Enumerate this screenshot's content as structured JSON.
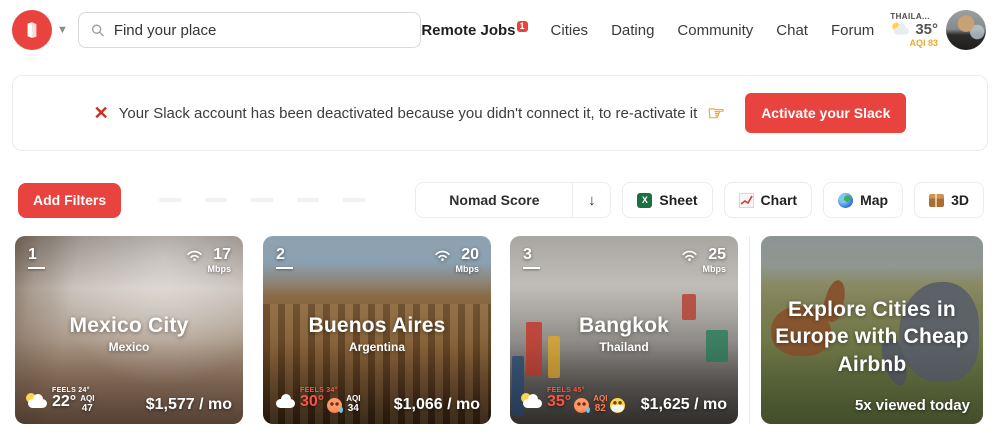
{
  "colors": {
    "accent": "#e8433f",
    "hot_red": "#ff5146",
    "aqi_orange": "#f5a623",
    "aqi_warn": "#ff7a50",
    "white": "#ffffff"
  },
  "header": {
    "logo_icon": "nomadlist-map-logo",
    "search": {
      "placeholder": "Find your place",
      "icon": "search-icon"
    },
    "nav": [
      {
        "label": "Remote Jobs",
        "badge": "1"
      },
      {
        "label": "Cities"
      },
      {
        "label": "Dating"
      },
      {
        "label": "Community"
      },
      {
        "label": "Chat"
      },
      {
        "label": "Forum"
      }
    ],
    "weather": {
      "location": "THAILA...",
      "icon": "sun-behind-cloud",
      "temp": "35°",
      "aqi": "AQI 83"
    }
  },
  "banner": {
    "icon": "✕",
    "text": "Your Slack account has been deactivated because you didn't connect it, to re-activate it",
    "pointer_icon": "☞",
    "button_label": "Activate your Slack"
  },
  "toolbar": {
    "add_filters_label": "Add Filters",
    "sort": {
      "selected": "Nomad Score",
      "direction_icon": "↓"
    },
    "view_buttons": [
      {
        "icon": "spreadsheet-icon",
        "label": "Sheet"
      },
      {
        "icon": "chart-icon",
        "label": "Chart"
      },
      {
        "icon": "globe-icon",
        "label": "Map"
      },
      {
        "icon": "package-icon",
        "label": "3D"
      }
    ]
  },
  "cards": [
    {
      "rank": "1",
      "speed": "17",
      "speed_unit": "Mbps",
      "title": "Mexico City",
      "country": "Mexico",
      "weather_icon": "sun-behind-cloud",
      "feels_like": "FEELS 24°",
      "feels_color": "#ffffff",
      "temp": "22°",
      "temp_color": "#ffffff",
      "aqi_label": "AQI",
      "aqi_value": "47",
      "aqi_color": "#ffffff",
      "price": "$1,577 / mo"
    },
    {
      "rank": "2",
      "speed": "20",
      "speed_unit": "Mbps",
      "title": "Buenos Aires",
      "country": "Argentina",
      "weather_icon": "cloud",
      "feels_like": "FEELS 34°",
      "feels_color": "#ff5146",
      "temp": "30°",
      "temp_color": "#ff5146",
      "aqi_label": "AQI",
      "aqi_value": "34",
      "aqi_color": "#ffffff",
      "faces": [
        "hot-face"
      ],
      "price": "$1,066 / mo"
    },
    {
      "rank": "3",
      "speed": "25",
      "speed_unit": "Mbps",
      "title": "Bangkok",
      "country": "Thailand",
      "weather_icon": "sun-behind-cloud",
      "feels_like": "FEELS 45°",
      "feels_color": "#ff5146",
      "temp": "35°",
      "temp_color": "#ff5146",
      "aqi_label": "AQI",
      "aqi_value": "82",
      "aqi_color": "#ff7a50",
      "faces": [
        "hot-face",
        "mask-face"
      ],
      "price": "$1,625 / mo"
    }
  ],
  "promo": {
    "title": "Explore Cities in Europe with Cheap Airbnb",
    "caption": "5x viewed today"
  }
}
